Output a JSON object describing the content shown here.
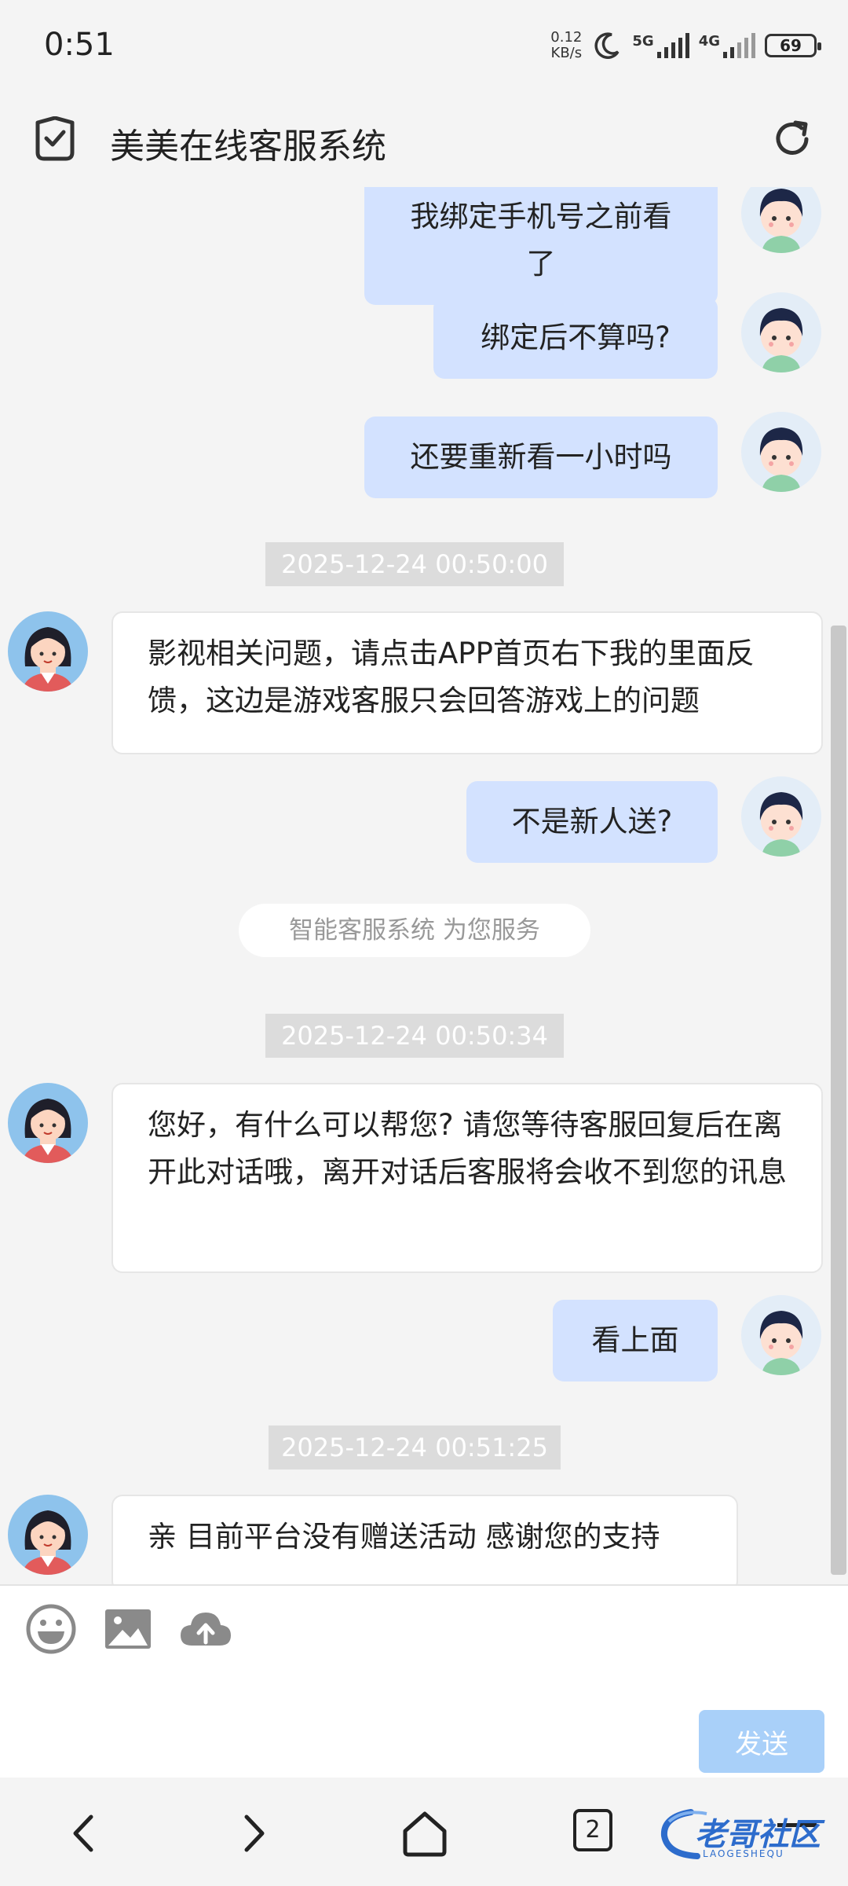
{
  "status_bar": {
    "time": "0:51",
    "speed_value": "0.12",
    "speed_unit": "KB/s",
    "net1": "5G",
    "net2": "4G",
    "battery": "69"
  },
  "header": {
    "title": "美美在线客服系统"
  },
  "messages": [
    {
      "text": "我绑定手机号之前看了"
    },
    {
      "text": "绑定后不算吗?"
    },
    {
      "text": "还要重新看一小时吗"
    },
    {
      "timestamp": "2025-12-24 00:50:00"
    },
    {
      "text": "影视相关问题，请点击APP首页右下我的里面反馈，这边是游戏客服只会回答游戏上的问题"
    },
    {
      "text": "不是新人送?"
    },
    {
      "system": "智能客服系统 为您服务"
    },
    {
      "timestamp": "2025-12-24 00:50:34"
    },
    {
      "text": "您好，有什么可以帮您? 请您等待客服回复后在离开此对话哦，离开对话后客服将会收不到您的讯息"
    },
    {
      "text": "看上面"
    },
    {
      "timestamp": "2025-12-24 00:51:25"
    },
    {
      "text": "亲 目前平台没有赠送活动 感谢您的支持"
    }
  ],
  "input": {
    "send_label": "发送"
  },
  "navbar": {
    "tab_count": "2"
  },
  "watermark": {
    "text": "老哥社区",
    "sub": "LAOGESHEQU"
  }
}
